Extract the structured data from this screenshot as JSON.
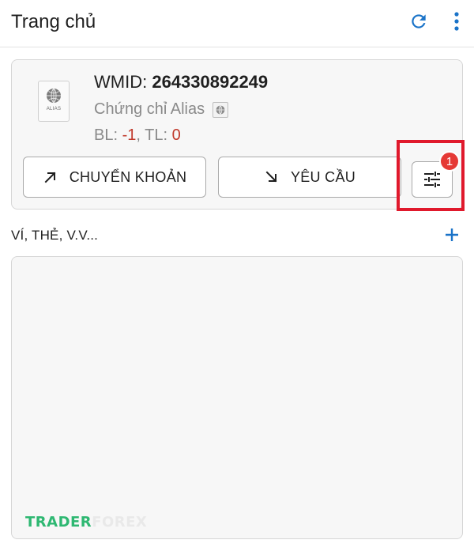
{
  "header": {
    "title": "Trang chủ",
    "refresh_icon": "refresh-icon",
    "more_icon": "more-vertical-icon"
  },
  "account": {
    "wmid_label": "WMID:",
    "wmid_value": "264330892249",
    "cert_text": "Chứng chỉ Alias",
    "cert_icon_label": "ALIAS",
    "bl_label": "BL:",
    "bl_value": "-1",
    "tl_label": "TL:",
    "tl_value": "0",
    "transfer_label": "CHUYỂN KHOẢN",
    "request_label": "YÊU CẦU",
    "filter_icon": "sliders-icon",
    "badge_count": "1"
  },
  "wallets": {
    "section_title": "VÍ, THẺ, V.V...",
    "add_icon": "plus-icon"
  },
  "watermark": {
    "part1": "TRADER",
    "part2": "FOREX"
  },
  "colors": {
    "accent": "#1a73c8",
    "negative": "#c0392b",
    "highlight": "#e0192c",
    "badge": "#e53935"
  }
}
